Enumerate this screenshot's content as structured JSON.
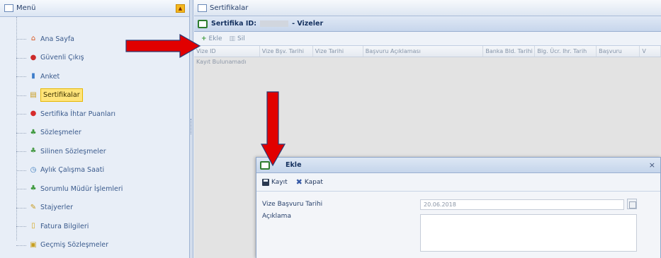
{
  "menu": {
    "title": "Menü",
    "collapse_glyph": "▲",
    "items": [
      {
        "label": "Ana Sayfa",
        "icon": "home-icon",
        "glyph": "⌂",
        "color": "#d9541e"
      },
      {
        "label": "Güvenli Çıkış",
        "icon": "exit-icon",
        "glyph": "●",
        "color": "#cc2a2a"
      },
      {
        "label": "Anket",
        "icon": "chart-icon",
        "glyph": "▮",
        "color": "#3d7cc9"
      },
      {
        "label": "Sertifikalar",
        "icon": "certificate-icon",
        "glyph": "▤",
        "color": "#c99a1a"
      },
      {
        "label": "Sertifika İhtar Puanları",
        "icon": "warning-icon",
        "glyph": "●",
        "color": "#d62c2c"
      },
      {
        "label": "Sözleşmeler",
        "icon": "people-icon",
        "glyph": "♣",
        "color": "#3f9a3f"
      },
      {
        "label": "Silinen Sözleşmeler",
        "icon": "people-icon",
        "glyph": "♣",
        "color": "#4e9e4e"
      },
      {
        "label": "Aylık Çalışma Saati",
        "icon": "clock-icon",
        "glyph": "◷",
        "color": "#3a7bbd"
      },
      {
        "label": "Sorumlu Müdür İşlemleri",
        "icon": "people-icon",
        "glyph": "♣",
        "color": "#3f9a3f"
      },
      {
        "label": "Stajyerler",
        "icon": "wand-icon",
        "glyph": "✎",
        "color": "#c79a1e"
      },
      {
        "label": "Fatura Bilgileri",
        "icon": "document-icon",
        "glyph": "▯",
        "color": "#d4a820"
      },
      {
        "label": "Geçmiş Sözleşmeler",
        "icon": "search-doc-icon",
        "glyph": "▣",
        "color": "#c8a020"
      }
    ],
    "selected_index": 3
  },
  "main": {
    "header_title": "Sertifikalar",
    "panel_prefix": "Sertifika ID:",
    "panel_suffix": "- Vizeler",
    "toolbar": {
      "add_label": "Ekle",
      "add_glyph": "+",
      "delete_label": "Sil",
      "delete_glyph": "▥"
    },
    "grid": {
      "columns": [
        "Vize ID",
        "Vize Bşv. Tarihi",
        "Vize Tarihi",
        "Başvuru Açıklaması",
        "Banka Bld. Tarihi",
        "Blg. Ücr. Ihr. Tarih",
        "Başvuru",
        "V"
      ],
      "empty_text": "Kayıt Bulunamadı"
    }
  },
  "dialog": {
    "title": "Ekle",
    "close_glyph": "×",
    "save_label": "Kayıt",
    "close_label": "Kapat",
    "close_icon_glyph": "✖",
    "fields": {
      "date_label": "Vize Başvuru Tarihi",
      "date_value": "20.06.2018",
      "description_label": "Açıklama",
      "description_value": ""
    }
  },
  "colors": {
    "arrow": "#e10000",
    "arrow_stroke": "#2b3a74"
  }
}
